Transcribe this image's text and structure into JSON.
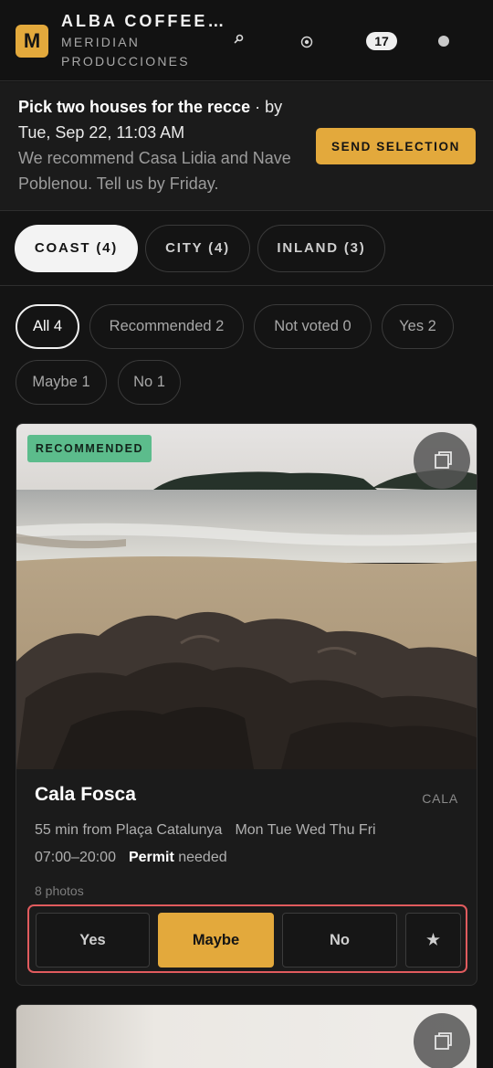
{
  "header": {
    "logo_letter": "M",
    "brand_title": "ALBA COFFEE…",
    "brand_subtitle": "MERIDIAN PRODUCCIONES",
    "notification_count": "17",
    "icons": [
      "search-icon",
      "target-icon",
      "avatar-dot-icon"
    ]
  },
  "banner": {
    "title": "Pick two houses for the recce",
    "deadline_prefix": " · by ",
    "deadline": "Tue, Sep 22, 11:03 AM",
    "note": "We recommend Casa Lidia and Nave Poblenou. Tell us by Friday.",
    "send_label": "SEND SELECTION"
  },
  "region_tabs": [
    {
      "label": "COAST (4)",
      "active": true
    },
    {
      "label": "CITY (4)",
      "active": false
    },
    {
      "label": "INLAND (3)",
      "active": false
    }
  ],
  "filters": [
    {
      "label": "All 4",
      "active": true
    },
    {
      "label": "Recommended 2",
      "active": false
    },
    {
      "label": "Not voted 0",
      "active": false
    },
    {
      "label": "Yes 2",
      "active": false
    },
    {
      "label": "Maybe 1",
      "active": false
    },
    {
      "label": "No 1",
      "active": false
    }
  ],
  "card": {
    "badge": "RECOMMENDED",
    "name": "Cala Fosca",
    "type": "CALA",
    "distance": "55 min from Plaça Catalunya",
    "days": "Mon Tue Wed Thu Fri",
    "hours": "07:00–20:00",
    "permit_bold": "Permit",
    "permit_rest": " needed",
    "photos": "8 photos",
    "votes": {
      "yes": "Yes",
      "maybe": "Maybe",
      "no": "No",
      "star": "★"
    },
    "selected_vote": "Maybe"
  },
  "colors": {
    "accent": "#e3a93c",
    "recommended": "#5cbc8c",
    "focus_ring": "#e15b5e",
    "background": "#141414"
  }
}
